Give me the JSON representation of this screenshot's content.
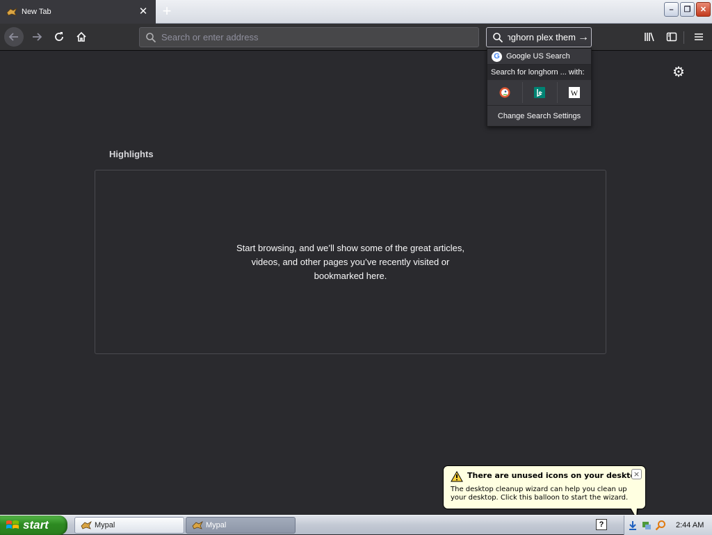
{
  "browser": {
    "tab": {
      "title": "New Tab",
      "close": "✕"
    },
    "new_tab": "+",
    "window_buttons": {
      "minimize": "–",
      "restore": "❐",
      "close": "✕"
    },
    "urlbar": {
      "placeholder": "Search or enter address",
      "value": ""
    },
    "searchbar": {
      "value": "longhorn plex them",
      "go": "→"
    },
    "search_popup": {
      "engine_header": "Google US Search",
      "search_for": "Search for longhorn ... with:",
      "change_settings": "Change Search Settings",
      "one_off_engines": [
        "DuckDuckGo",
        "Bing",
        "Wikipedia"
      ]
    }
  },
  "content": {
    "highlights_title": "Highlights",
    "empty_message": "Start browsing, and we’ll show some of the great articles, videos, and other pages you’ve recently visited or bookmarked here."
  },
  "balloon": {
    "title": "There are unused icons on your desktop",
    "text": "The desktop cleanup wizard can help you clean up your desktop. Click this balloon to start the wizard.",
    "close": "×"
  },
  "taskbar": {
    "start_label": "start",
    "items": [
      {
        "label": "Mypal",
        "active": false
      },
      {
        "label": "Mypal",
        "active": true
      }
    ],
    "help": "?",
    "clock": "2:44 AM"
  },
  "colors": {
    "content_bg": "#2a2a2e",
    "toolbar_bg": "#323234",
    "tab_bg": "#38383d",
    "balloon_bg": "#ffffe1",
    "start_green": "#2d8a21"
  }
}
